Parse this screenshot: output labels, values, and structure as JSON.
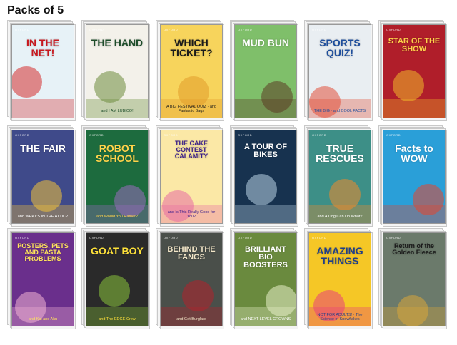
{
  "page_title": "Packs of 5",
  "brand": "OXFORD",
  "books": [
    {
      "title": "IN THE NET!",
      "sub": "",
      "bg": "#e7f2f7",
      "accent": "#d62d2d",
      "text": "#c8181e"
    },
    {
      "title": "THE HAND",
      "sub": "and I AM LUBICO!",
      "bg": "#f3f1ea",
      "accent": "#6b8b3a",
      "text": "#1d4d2a"
    },
    {
      "title": "WHICH TICKET?",
      "sub": "A BIG FESTIVAL QUIZ · and Fantastic Bags",
      "bg": "#f7d45c",
      "accent": "#e29a2a",
      "text": "#1a1a1a"
    },
    {
      "title": "MUD BUN",
      "sub": "",
      "bg": "#7fbf6a",
      "accent": "#5b3a22",
      "text": "#ffffff"
    },
    {
      "title": "SPORTS QUIZ!",
      "sub": "THE BIG · and COOL FACTS",
      "bg": "#e9eef2",
      "accent": "#e2513a",
      "text": "#1e4e9c"
    },
    {
      "title": "STAR OF THE SHOW",
      "sub": "",
      "bg": "#b01e2a",
      "accent": "#f0b829",
      "text": "#ffd34a"
    },
    {
      "title": "THE FAIR",
      "sub": "and WHAT'S IN THE ATTIC?",
      "bg": "#3f4a8a",
      "accent": "#f3c33a",
      "text": "#ffffff"
    },
    {
      "title": "ROBOT SCHOOL",
      "sub": "and Would You Rather?",
      "bg": "#1d6b3e",
      "accent": "#9b6bbf",
      "text": "#ffd34a"
    },
    {
      "title": "THE CAKE CONTEST CALAMITY",
      "sub": "and Is This Really Good for You?",
      "bg": "#fbe8a6",
      "accent": "#e86aa3",
      "text": "#3a1e8a"
    },
    {
      "title": "A TOUR OF BIKES",
      "sub": "",
      "bg": "#17324f",
      "accent": "#b9d4e6",
      "text": "#ffffff"
    },
    {
      "title": "TRUE RESCUES",
      "sub": "and A Dog Can Do What?",
      "bg": "#3d8f87",
      "accent": "#f08a2a",
      "text": "#ffffff"
    },
    {
      "title": "Facts to WOW",
      "sub": "",
      "bg": "#2a9fd8",
      "accent": "#e6442e",
      "text": "#ffffff"
    },
    {
      "title": "POSTERS, PETS AND PASTA PROBLEMS",
      "sub": "and Kai and Aku",
      "bg": "#6a2f8c",
      "accent": "#f1b3d4",
      "text": "#ffe45c"
    },
    {
      "title": "GOAT BOY",
      "sub": "and The EDGE Crew",
      "bg": "#2a2a2a",
      "accent": "#88c23a",
      "text": "#ffe23a"
    },
    {
      "title": "BEHIND THE FANGS",
      "sub": "and Got Burglars",
      "bg": "#4a4f4a",
      "accent": "#b2222b",
      "text": "#f2e6c8"
    },
    {
      "title": "BRILLIANT BIO BOOSTERS",
      "sub": "and NEXT LEVEL CROWNS",
      "bg": "#6a8a3e",
      "accent": "#e8f0c8",
      "text": "#ffffff"
    },
    {
      "title": "AMAZING THINGS",
      "sub": "NOT FOR ADULTS! · The Science of Snowflakes",
      "bg": "#f5c726",
      "accent": "#e83f7a",
      "text": "#1f3f8a"
    },
    {
      "title": "Return of the Golden Fleece",
      "sub": "",
      "bg": "#6b7a6b",
      "accent": "#d9a63a",
      "text": "#1a1a1a"
    }
  ]
}
